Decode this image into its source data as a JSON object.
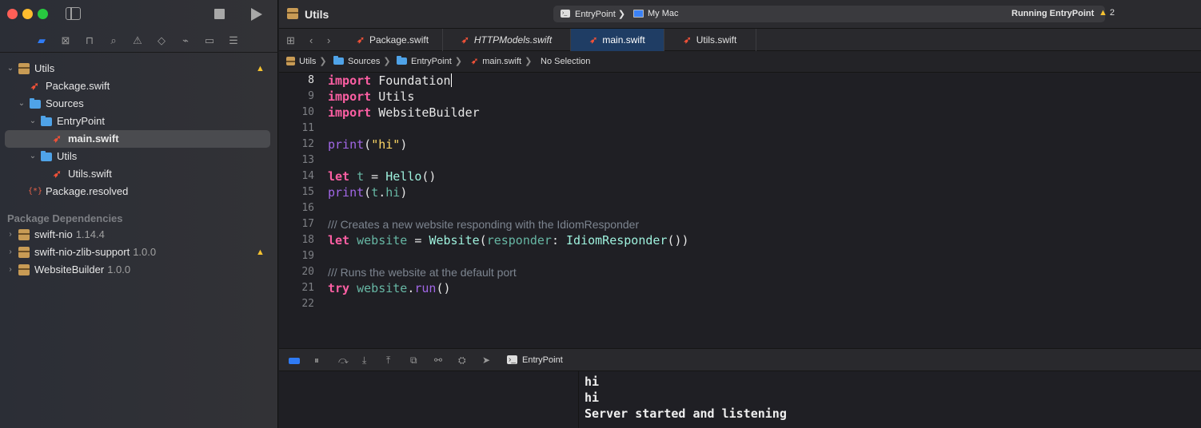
{
  "project": {
    "name": "Utils"
  },
  "scheme": {
    "target": "EntryPoint",
    "separator": "❯",
    "destination": "My Mac",
    "status": "Running EntryPoint",
    "warnings": "2"
  },
  "tabs": [
    {
      "label": "Package.swift",
      "italic": false,
      "active": false
    },
    {
      "label": "HTTPModels.swift",
      "italic": true,
      "active": false
    },
    {
      "label": "main.swift",
      "italic": false,
      "active": true
    },
    {
      "label": "Utils.swift",
      "italic": false,
      "active": false
    }
  ],
  "breadcrumb": [
    "Utils",
    "Sources",
    "EntryPoint",
    "main.swift",
    "No Selection"
  ],
  "navigator": {
    "items": [
      {
        "label": "Utils",
        "kind": "package",
        "warning": true
      },
      {
        "label": "Package.swift",
        "kind": "swift"
      },
      {
        "label": "Sources",
        "kind": "folder"
      },
      {
        "label": "EntryPoint",
        "kind": "folder"
      },
      {
        "label": "main.swift",
        "kind": "swift",
        "selected": true
      },
      {
        "label": "Utils",
        "kind": "folder"
      },
      {
        "label": "Utils.swift",
        "kind": "swift"
      },
      {
        "label": "Package.resolved",
        "kind": "resolved",
        "icon_text": "{*}"
      }
    ],
    "dependencies_header": "Package Dependencies",
    "dependencies": [
      {
        "name": "swift-nio",
        "version": "1.14.4",
        "warning": false
      },
      {
        "name": "swift-nio-zlib-support",
        "version": "1.0.0",
        "warning": true
      },
      {
        "name": "WebsiteBuilder",
        "version": "1.0.0",
        "warning": false
      }
    ]
  },
  "code": {
    "lines": [
      {
        "n": "8",
        "segments": [
          [
            "kw",
            "import"
          ],
          [
            "p",
            " Foundation"
          ]
        ],
        "cursor": true
      },
      {
        "n": "9",
        "segments": [
          [
            "kw",
            "import"
          ],
          [
            "p",
            " Utils"
          ]
        ]
      },
      {
        "n": "10",
        "segments": [
          [
            "kw",
            "import"
          ],
          [
            "p",
            " WebsiteBuilder"
          ]
        ]
      },
      {
        "n": "11",
        "segments": []
      },
      {
        "n": "12",
        "segments": [
          [
            "fn",
            "print"
          ],
          [
            "p",
            "("
          ],
          [
            "str y",
            "\"hi\""
          ],
          [
            "p",
            ")"
          ]
        ]
      },
      {
        "n": "13",
        "segments": []
      },
      {
        "n": "14",
        "segments": [
          [
            "kw",
            "let"
          ],
          [
            "p",
            " "
          ],
          [
            "var",
            "t"
          ],
          [
            "p",
            " = "
          ],
          [
            "ty",
            "Hello"
          ],
          [
            "p",
            "()"
          ]
        ]
      },
      {
        "n": "15",
        "segments": [
          [
            "fn",
            "print"
          ],
          [
            "p",
            "("
          ],
          [
            "var",
            "t"
          ],
          [
            "p",
            "."
          ],
          [
            "var",
            "hi"
          ],
          [
            "p",
            ")"
          ]
        ]
      },
      {
        "n": "16",
        "segments": []
      },
      {
        "n": "17",
        "segments": [
          [
            "cm",
            "/// "
          ],
          [
            "cm",
            "Creates a new website responding with the IdiomResponder"
          ]
        ]
      },
      {
        "n": "18",
        "segments": [
          [
            "kw",
            "let"
          ],
          [
            "p",
            " "
          ],
          [
            "var",
            "website"
          ],
          [
            "p",
            " = "
          ],
          [
            "ty",
            "Website"
          ],
          [
            "p",
            "("
          ],
          [
            "var",
            "responder"
          ],
          [
            "p",
            ": "
          ],
          [
            "ty",
            "IdiomResponder"
          ],
          [
            "p",
            "())"
          ]
        ]
      },
      {
        "n": "19",
        "segments": []
      },
      {
        "n": "20",
        "segments": [
          [
            "cm",
            "/// "
          ],
          [
            "cm",
            "Runs the website at the default port"
          ]
        ]
      },
      {
        "n": "21",
        "segments": [
          [
            "kw",
            "try"
          ],
          [
            "p",
            " "
          ],
          [
            "var",
            "website"
          ],
          [
            "p",
            "."
          ],
          [
            "fn",
            "run"
          ],
          [
            "p",
            "()"
          ]
        ]
      },
      {
        "n": "22",
        "segments": []
      }
    ]
  },
  "debug": {
    "target": "EntryPoint"
  },
  "console": {
    "lines": [
      "hi",
      "hi",
      "Server started and listening"
    ]
  }
}
